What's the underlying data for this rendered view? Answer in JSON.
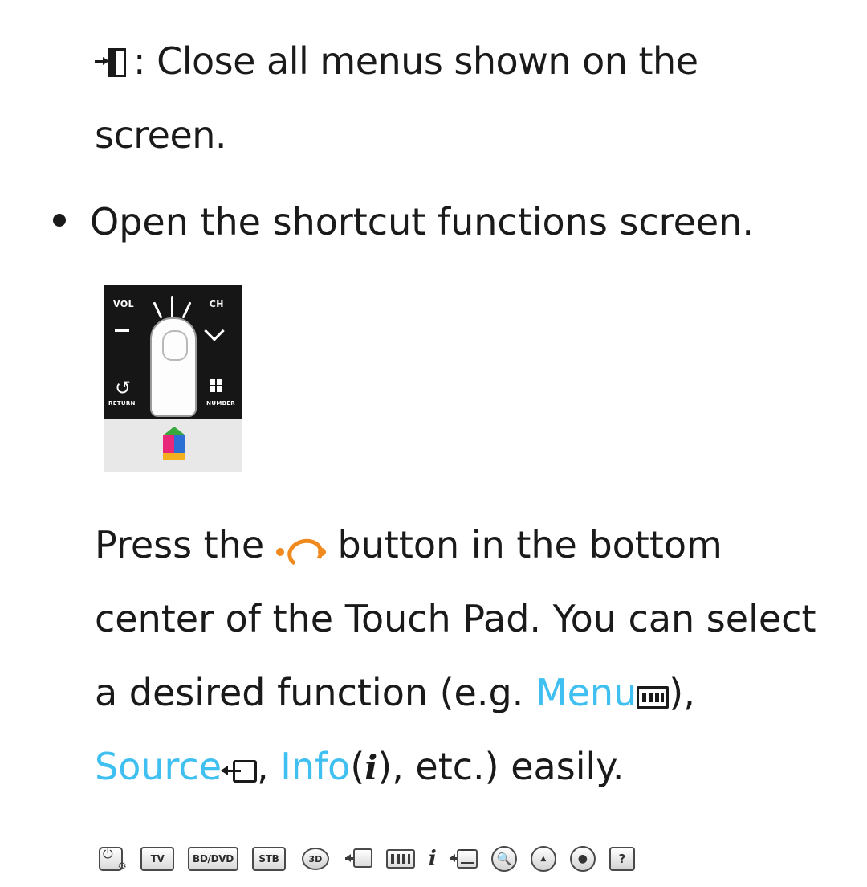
{
  "page": {
    "exit": {
      "icon": "exit-door-icon",
      "line1": ": Close all menus shown on the",
      "line2": "screen."
    },
    "bullet": {
      "marker": "•",
      "text": "Open the shortcut functions screen."
    },
    "remote_illustration": {
      "vol_label": "VOL",
      "ch_label": "CH",
      "minus_symbol": "−",
      "chevron": "chevron-down",
      "return_label": "RETURN",
      "number_label": "NUMBER",
      "cube_icon": "samsung-smart-hub-cube"
    },
    "paragraph": {
      "line1_a": "Press the",
      "line1_icon": "touch-pad-swirl-icon",
      "line1_b": "button in the bottom",
      "line2": "center of the Touch Pad. You can select",
      "line3_a": "a desired function (e.g.",
      "line3_menu": "Menu",
      "line3_menu_icon": "menu-grid-icon",
      "line3_b": "),",
      "line4_source": "Source",
      "line4_source_icon": "source-arrow-icon",
      "line4_mid": ", ",
      "line4_info": "Info",
      "line4_info_icon": "i",
      "line4_end": ", etc.) easily."
    },
    "colors": {
      "accent": "#3fc0f0",
      "text": "#1a1a1a",
      "remote_body": "#e8e8e8",
      "remote_dark": "#161616",
      "touch_icon": "#f08a1e"
    },
    "icon_strip": [
      {
        "name": "power-settings-icon",
        "label": ""
      },
      {
        "name": "tv-icon",
        "label": "TV"
      },
      {
        "name": "bd-dvd-icon",
        "label": "BD/DVD"
      },
      {
        "name": "stb-icon",
        "label": "STB"
      },
      {
        "name": "three-d-icon",
        "label": "3D"
      },
      {
        "name": "source-icon",
        "label": ""
      },
      {
        "name": "menu-icon",
        "label": ""
      },
      {
        "name": "info-icon",
        "label": "i"
      },
      {
        "name": "caption-icon",
        "label": ""
      },
      {
        "name": "search-icon",
        "label": ""
      },
      {
        "name": "recommend-icon",
        "label": ""
      },
      {
        "name": "smart-hub-icon",
        "label": ""
      },
      {
        "name": "help-icon",
        "label": "?"
      }
    ]
  }
}
